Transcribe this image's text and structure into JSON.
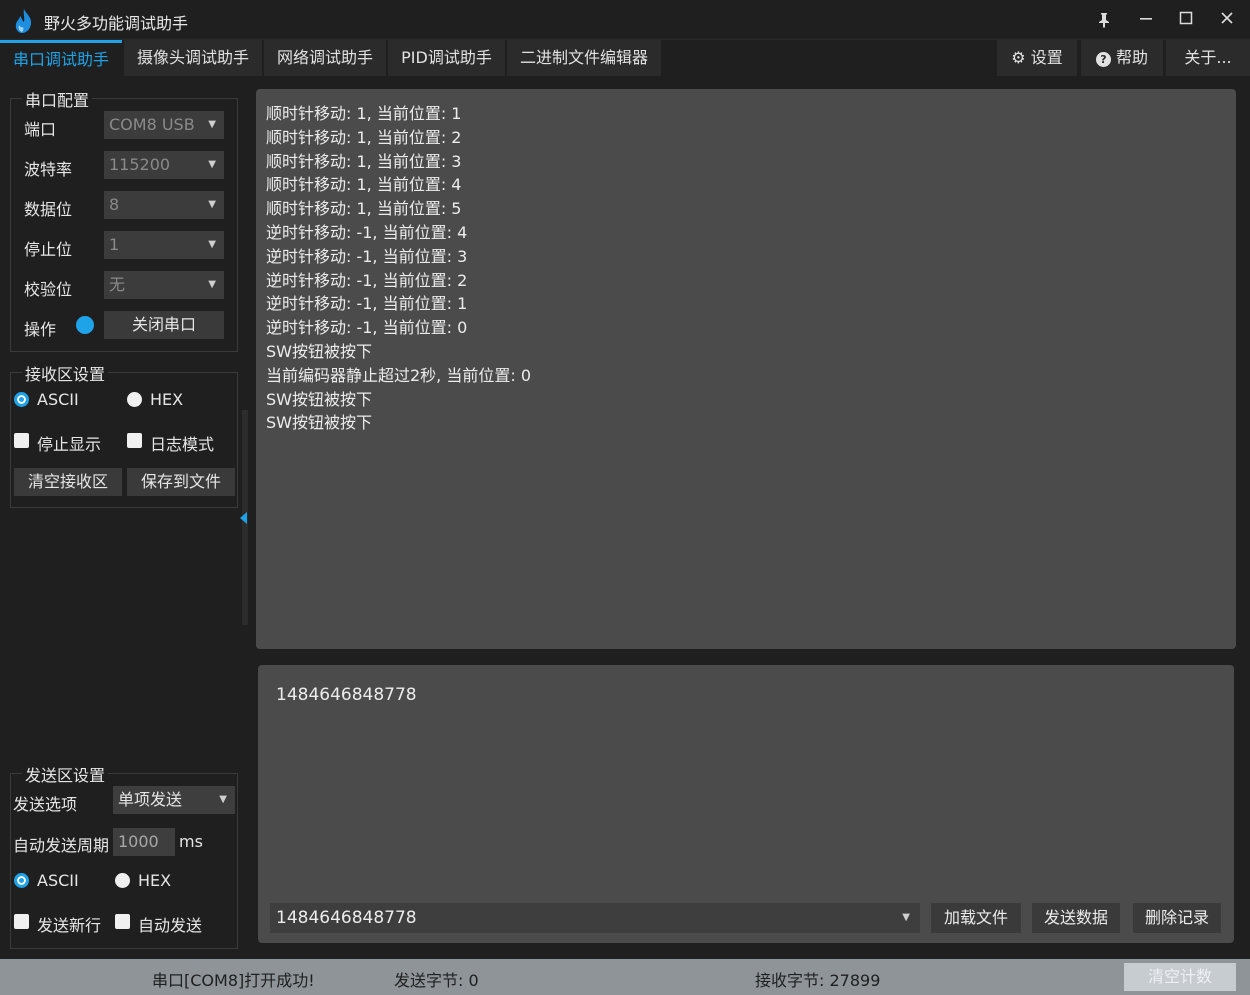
{
  "window": {
    "title": "野火多功能调试助手",
    "buttons": {
      "pin": "📌",
      "minimize": "—",
      "maximize": "☐",
      "close": "✕"
    }
  },
  "tabs": [
    "串口调试助手",
    "摄像头调试助手",
    "网络调试助手",
    "PID调试助手",
    "二进制文件编辑器"
  ],
  "right_tabs": {
    "settings": "设置",
    "help": "帮助",
    "about": "关于..."
  },
  "serial_config": {
    "title": "串口配置",
    "port_label": "端口",
    "port_value": "COM8 USB",
    "baud_label": "波特率",
    "baud_value": "115200",
    "databits_label": "数据位",
    "databits_value": "8",
    "stopbits_label": "停止位",
    "stopbits_value": "1",
    "parity_label": "校验位",
    "parity_value": "无",
    "op_label": "操作",
    "close_port_button": "关闭串口"
  },
  "recv_settings": {
    "title": "接收区设置",
    "ascii": "ASCII",
    "hex": "HEX",
    "stop_display": "停止显示",
    "log_mode": "日志模式",
    "clear_button": "清空接收区",
    "save_button": "保存到文件"
  },
  "send_settings": {
    "title": "发送区设置",
    "option_label": "发送选项",
    "option_value": "单项发送",
    "period_label": "自动发送周期",
    "period_value": "1000",
    "period_unit": "ms",
    "ascii": "ASCII",
    "hex": "HEX",
    "newline": "发送新行",
    "auto_send": "自动发送"
  },
  "receive_lines": [
    "顺时针移动: 1, 当前位置: 1",
    "顺时针移动: 1, 当前位置: 2",
    "顺时针移动: 1, 当前位置: 3",
    "顺时针移动: 1, 当前位置: 4",
    "顺时针移动: 1, 当前位置: 5",
    "逆时针移动: -1, 当前位置: 4",
    "逆时针移动: -1, 当前位置: 3",
    "逆时针移动: -1, 当前位置: 2",
    "逆时针移动: -1, 当前位置: 1",
    "逆时针移动: -1, 当前位置: 0",
    "SW按钮被按下",
    "当前编码器静止超过2秒, 当前位置: 0",
    "SW按钮被按下",
    "SW按钮被按下"
  ],
  "send": {
    "text": "1484646848778",
    "history_value": "1484646848778",
    "load_file": "加载文件",
    "send_data": "发送数据",
    "delete_history": "删除记录"
  },
  "status": {
    "port_status": "串口[COM8]打开成功!",
    "sent_bytes": "发送字节: 0",
    "recv_bytes": "接收字节: 27899",
    "clear_count": "清空计数"
  },
  "colors": {
    "accent": "#1ea3e8",
    "indicator": "#1ea3e8"
  }
}
